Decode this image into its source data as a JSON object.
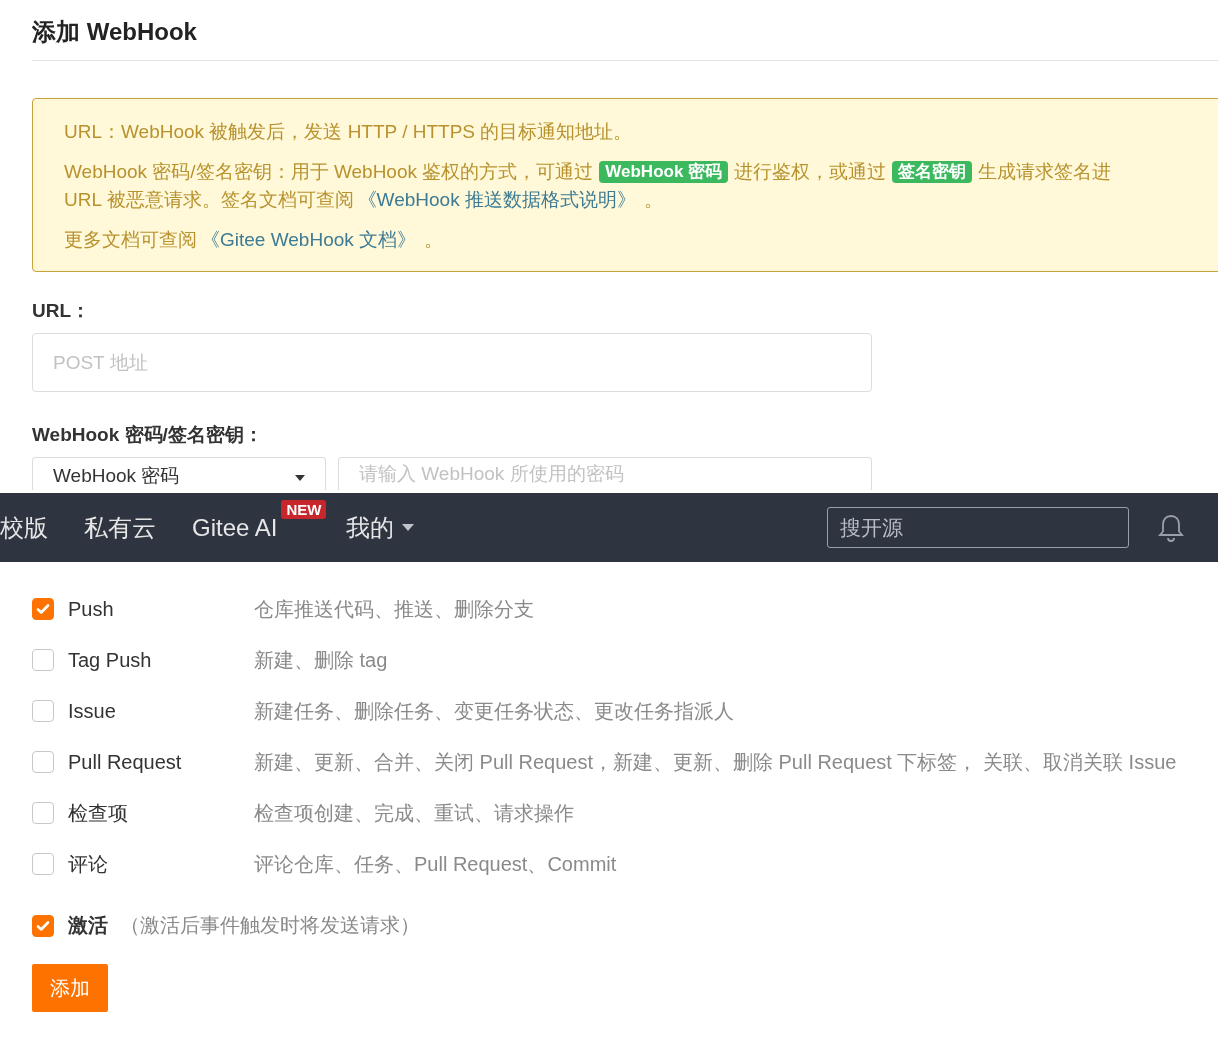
{
  "title": "添加 WebHook",
  "notice": {
    "paragraphs": [
      {
        "lines": [
          [
            {
              "kind": "text",
              "text": "URL：WebHook 被触发后，发送 HTTP / HTTPS 的目标通知地址。"
            }
          ]
        ]
      },
      {
        "lines": [
          [
            {
              "kind": "text",
              "text": "WebHook 密码/签名密钥：用于 WebHook 鉴权的方式，可通过"
            },
            {
              "kind": "badge",
              "text": "WebHook 密码"
            },
            {
              "kind": "text",
              "text": "进行鉴权，或通过"
            },
            {
              "kind": "badge",
              "text": "签名密钥"
            },
            {
              "kind": "text",
              "text": "生成请求签名进"
            }
          ],
          [
            {
              "kind": "text",
              "text": "URL 被恶意请求。签名文档可查阅"
            },
            {
              "kind": "link",
              "text": "《WebHook 推送数据格式说明》"
            },
            {
              "kind": "text",
              "text": "。"
            }
          ]
        ]
      },
      {
        "lines": [
          [
            {
              "kind": "text",
              "text": "更多文档可查阅"
            },
            {
              "kind": "link",
              "text": "《Gitee WebHook 文档》"
            },
            {
              "kind": "text",
              "text": "。"
            }
          ]
        ]
      }
    ]
  },
  "url": {
    "label": "URL：",
    "placeholder": "POST 地址"
  },
  "secret": {
    "label": "WebHook 密码/签名密钥：",
    "select_value": "WebHook 密码",
    "placeholder": "请输入 WebHook 所使用的密码"
  },
  "events": {
    "items": [
      {
        "name": "Push",
        "description": "仓库推送代码、推送、删除分支",
        "checked": true
      },
      {
        "name": "Tag Push",
        "description": "新建、删除 tag",
        "checked": false
      },
      {
        "name": "Issue",
        "description": "新建任务、删除任务、变更任务状态、更改任务指派人",
        "checked": false
      },
      {
        "name": "Pull Request",
        "description": "新建、更新、合并、关闭 Pull Request，新建、更新、删除 Pull Request 下标签， 关联、取消关联 Issue",
        "checked": false
      },
      {
        "name": "检查项",
        "description": "检查项创建、完成、重试、请求操作",
        "checked": false
      },
      {
        "name": "评论",
        "description": "评论仓库、任务、Pull Request、Commit",
        "checked": false
      }
    ]
  },
  "active": {
    "label": "激活",
    "hint": "（激活后事件触发时将发送请求）",
    "checked": true
  },
  "submit": "添加",
  "navbar": {
    "items": [
      {
        "label": "校版"
      },
      {
        "label": "私有云"
      },
      {
        "label": "Gitee AI",
        "badge": "NEW"
      },
      {
        "label": "我的",
        "dropdown": true
      }
    ],
    "search_placeholder": "搜开源"
  }
}
